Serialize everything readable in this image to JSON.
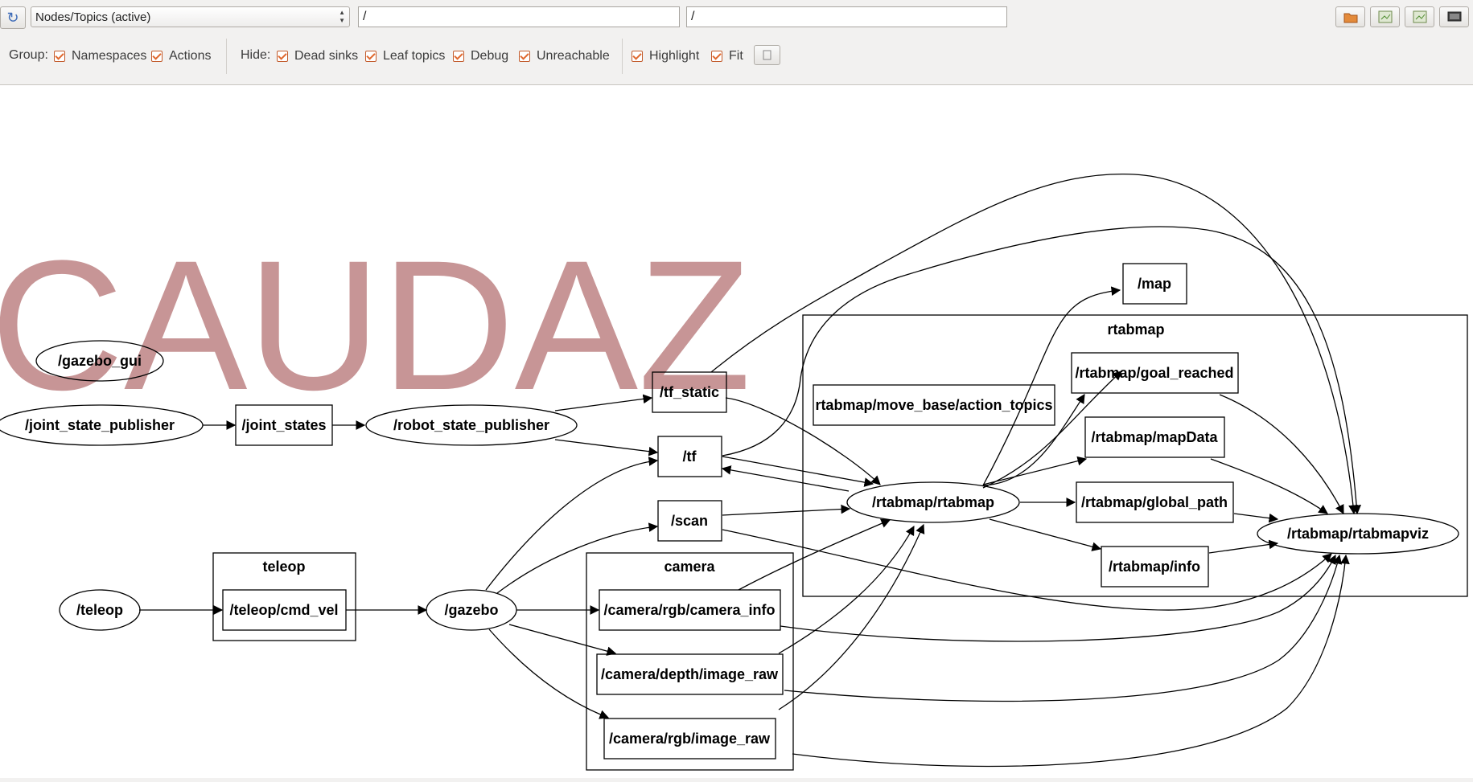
{
  "toolbar": {
    "graph_mode": "Nodes/Topics (active)",
    "ns_filter": "/",
    "topic_filter": "/"
  },
  "options": {
    "group_label": "Group:",
    "namespaces": "Namespaces",
    "actions": "Actions",
    "hide_label": "Hide:",
    "dead_sinks": "Dead sinks",
    "leaf_topics": "Leaf topics",
    "debug": "Debug",
    "unreachable": "Unreachable",
    "highlight": "Highlight",
    "fit": "Fit"
  },
  "watermark": "CAUDAZ",
  "clusters": {
    "rtabmap": "rtabmap",
    "teleop": "teleop",
    "camera": "camera"
  },
  "nodes": {
    "gazebo_gui": "/gazebo_gui",
    "joint_state_publisher": "/joint_state_publisher",
    "joint_states": "/joint_states",
    "robot_state_publisher": "/robot_state_publisher",
    "tf_static": "/tf_static",
    "tf": "/tf",
    "scan": "/scan",
    "teleop": "/teleop",
    "teleop_cmd_vel": "/teleop/cmd_vel",
    "gazebo": "/gazebo",
    "camera_info": "/camera/rgb/camera_info",
    "depth_image": "/camera/depth/image_raw",
    "rgb_image": "/camera/rgb/image_raw",
    "map": "/map",
    "action_topics": "rtabmap/move_base/action_topics",
    "goal_reached": "/rtabmap/goal_reached",
    "mapdata": "/rtabmap/mapData",
    "global_path": "/rtabmap/global_path",
    "info": "/rtabmap/info",
    "rtabmap": "/rtabmap/rtabmap",
    "rtabmapviz": "/rtabmap/rtabmapviz"
  }
}
